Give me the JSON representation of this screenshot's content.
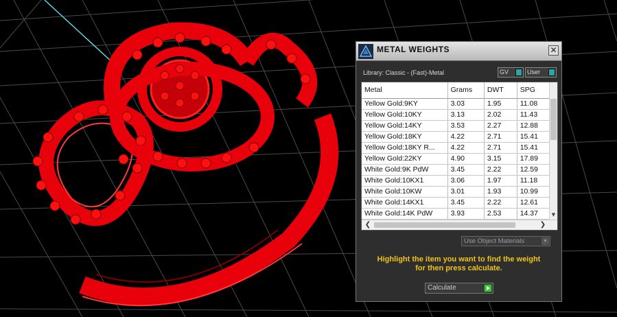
{
  "window": {
    "title": "METAL WEIGHTS",
    "close_glyph": "✕",
    "logo_icon": "gemvision-logo-icon"
  },
  "library": {
    "label": "Library: Classic - (Fast)-Metal",
    "gv_toggle": "GV",
    "user_toggle": "User"
  },
  "table": {
    "columns": [
      "Metal",
      "Grams",
      "DWT",
      "SPG"
    ],
    "rows": [
      {
        "metal": "Yellow Gold:9KY",
        "grams": "3.03",
        "dwt": "1.95",
        "spg": "11.08"
      },
      {
        "metal": "Yellow Gold:10KY",
        "grams": "3.13",
        "dwt": "2.02",
        "spg": "11.43"
      },
      {
        "metal": "Yellow Gold:14KY",
        "grams": "3.53",
        "dwt": "2.27",
        "spg": "12.88"
      },
      {
        "metal": "Yellow Gold:18KY",
        "grams": "4.22",
        "dwt": "2.71",
        "spg": "15.41"
      },
      {
        "metal": "Yellow Gold:18KY R...",
        "grams": "4.22",
        "dwt": "2.71",
        "spg": "15.41"
      },
      {
        "metal": "Yellow Gold:22KY",
        "grams": "4.90",
        "dwt": "3.15",
        "spg": "17.89"
      },
      {
        "metal": "White Gold:9K PdW",
        "grams": "3.45",
        "dwt": "2.22",
        "spg": "12.59"
      },
      {
        "metal": "White Gold:10KX1",
        "grams": "3.06",
        "dwt": "1.97",
        "spg": "11.18"
      },
      {
        "metal": "White Gold:10KW",
        "grams": "3.01",
        "dwt": "1.93",
        "spg": "10.99"
      },
      {
        "metal": "White Gold:14KX1",
        "grams": "3.45",
        "dwt": "2.22",
        "spg": "12.61"
      },
      {
        "metal": "White Gold:14K PdW",
        "grams": "3.93",
        "dwt": "2.53",
        "spg": "14.37"
      }
    ],
    "scroll_left": "❮",
    "scroll_right": "❯",
    "scroll_down": "▼"
  },
  "materials_dropdown": {
    "value": "Use Object Materials",
    "arrow_glyph": "▾"
  },
  "instruction": {
    "line1": "Highlight the item you want to find the weight",
    "line2": "for then press calculate."
  },
  "calculate": {
    "label": "Calculate"
  },
  "colors": {
    "ring": "#e8000a",
    "grid": "#4a4a4a",
    "axis": "#5fd3e6",
    "accent_toggle": "#2ea6a0",
    "instruction_text": "#f0c419"
  }
}
